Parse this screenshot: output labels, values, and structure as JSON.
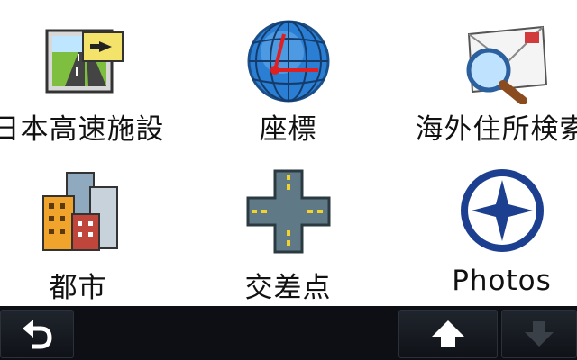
{
  "menu": {
    "items": [
      {
        "label": "日本高速施設",
        "icon": "highway-facilities-icon"
      },
      {
        "label": "座標",
        "icon": "globe-coordinates-icon"
      },
      {
        "label": "海外住所検索",
        "icon": "envelope-search-icon"
      },
      {
        "label": "都市",
        "icon": "city-buildings-icon"
      },
      {
        "label": "交差点",
        "icon": "intersection-icon"
      },
      {
        "label": "Photos",
        "icon": "compass-photos-icon"
      }
    ]
  },
  "toolbar": {
    "back": "back-arrow-icon",
    "up": "up-arrow-icon",
    "down": "down-arrow-icon"
  },
  "colors": {
    "background": "#ffffff",
    "toolbar": "#0d0f14",
    "globe": "#2a7fd4",
    "compass": "#1d3f8f"
  }
}
